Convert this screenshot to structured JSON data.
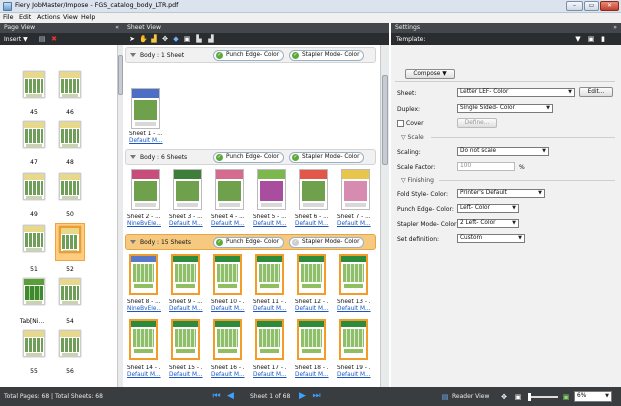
{
  "window": {
    "title": "Fiery JobMaster/Impose - FGS_catalog_body_LTR.pdf",
    "min": "–",
    "max": "▭",
    "close": "✕"
  },
  "menu": [
    "File",
    "Edit",
    "Actions",
    "View",
    "Help"
  ],
  "page_view": {
    "header": "Page View",
    "collapse": "«",
    "insert_label": "Insert ▼",
    "pages": [
      {
        "n": "45"
      },
      {
        "n": "46"
      },
      {
        "n": "47"
      },
      {
        "n": "48"
      },
      {
        "n": "49"
      },
      {
        "n": "50"
      },
      {
        "n": "51"
      },
      {
        "n": "52"
      },
      {
        "n": "Tab[Ni..."
      },
      {
        "n": "54"
      },
      {
        "n": "55"
      },
      {
        "n": "56"
      }
    ]
  },
  "sheet_view": {
    "header": "Sheet View",
    "groups": [
      {
        "label": "Body : 1 Sheet",
        "chips": [
          "Punch Edge- Color",
          "Stapler Mode- Color"
        ],
        "sheets": [
          {
            "name": "Sheet 1 - ...",
            "sub": "Default M..."
          }
        ]
      },
      {
        "label": "Body : 6 Sheets",
        "chips": [
          "Punch Edge- Color",
          "Stapler Mode- Color"
        ],
        "sheets": [
          {
            "name": "Sheet 2 - ...",
            "sub": "NineBvEle..."
          },
          {
            "name": "Sheet 3 - ...",
            "sub": "Default M..."
          },
          {
            "name": "Sheet 4 - ...",
            "sub": "Default M..."
          },
          {
            "name": "Sheet 5 - ...",
            "sub": "Default M..."
          },
          {
            "name": "Sheet 6 - ...",
            "sub": "Default M..."
          },
          {
            "name": "Sheet 7 - ...",
            "sub": "Default M..."
          }
        ]
      },
      {
        "label": "Body : 15 Sheets",
        "chips": [
          "Punch Edge- Color",
          "Stapler Mode- Color"
        ],
        "sheets": [
          {
            "name": "Sheet 8 - ...",
            "sub": "NineBvEle..."
          },
          {
            "name": "Sheet 9 - ...",
            "sub": "Default M..."
          },
          {
            "name": "Sheet 10 - ...",
            "sub": "Default M..."
          },
          {
            "name": "Sheet 11 - ...",
            "sub": "Default M..."
          },
          {
            "name": "Sheet 12 - ...",
            "sub": "Default M..."
          },
          {
            "name": "Sheet 13 - ...",
            "sub": "Default M..."
          },
          {
            "name": "Sheet 14 - ...",
            "sub": "Default M..."
          },
          {
            "name": "Sheet 15 - ...",
            "sub": "Default M..."
          },
          {
            "name": "Sheet 16 - ...",
            "sub": "Default M..."
          },
          {
            "name": "Sheet 17 - ...",
            "sub": "Default M..."
          },
          {
            "name": "Sheet 18 - ...",
            "sub": "Default M..."
          },
          {
            "name": "Sheet 19 - ...",
            "sub": "Default M..."
          }
        ]
      }
    ]
  },
  "settings": {
    "header": "Settings",
    "expand": "»",
    "template_label": "Template:",
    "compose": "Compose",
    "sheet_label": "Sheet:",
    "sheet_value": "Letter LEF- Color",
    "edit_btn": "Edit...",
    "duplex_label": "Duplex:",
    "duplex_value": "Single Sided- Color",
    "cover_label": "Cover",
    "define_btn": "Define...",
    "scale_section": "Scale",
    "scaling_label": "Scaling:",
    "scaling_value": "Do not scale",
    "scale_factor_label": "Scale Factor:",
    "scale_factor_value": "100",
    "scale_factor_unit": "%",
    "finishing_section": "Finishing",
    "fold_label": "Fold Style- Color:",
    "fold_value": "Printer's Default",
    "punch_label": "Punch Edge- Color:",
    "punch_value": "Left- Color",
    "stapler_label": "Stapler Mode- Color:",
    "stapler_value": "2 Left- Color",
    "setdef_label": "Set definition:",
    "setdef_value": "Custom"
  },
  "status": {
    "totals": "Total Pages: 68 | Total Sheets: 68",
    "sheet_of": "Sheet 1 of 68",
    "reader_view": "Reader View",
    "zoom": "6%"
  }
}
